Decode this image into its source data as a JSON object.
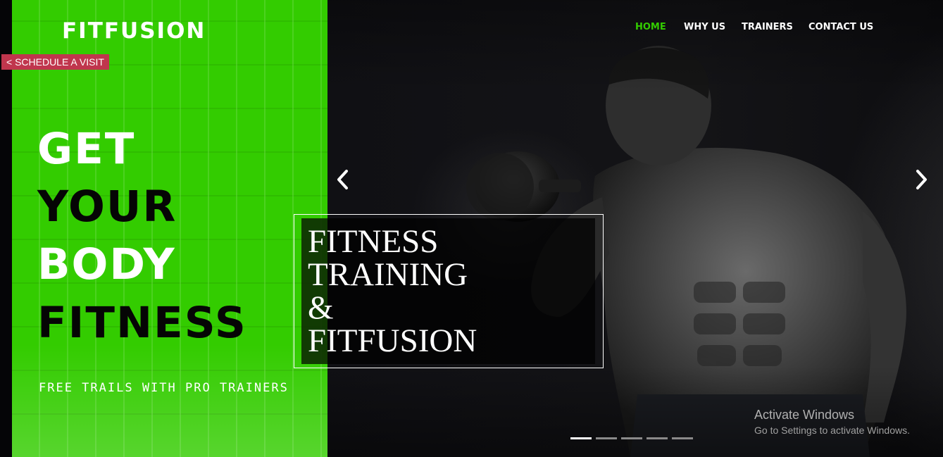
{
  "brand": {
    "name": "FITFUSION"
  },
  "schedule_button": {
    "label": "< SCHEDULE A VISIT"
  },
  "nav": {
    "items": [
      {
        "label": "HOME",
        "active": true
      },
      {
        "label": "WHY US",
        "active": false
      },
      {
        "label": "TRAINERS",
        "active": false
      },
      {
        "label": "CONTACT US",
        "active": false
      }
    ]
  },
  "hero": {
    "headline": [
      "GET",
      "YOUR",
      "BODY",
      "FITNESS"
    ],
    "tagline": "FREE TRAILS WITH PRO TRAINERS",
    "feature_lines": [
      "FITNESS",
      "TRAINING",
      "&",
      "FITFUSION"
    ]
  },
  "carousel": {
    "prev_icon": "chevron-left-icon",
    "next_icon": "chevron-right-icon",
    "slide_count": 5,
    "active_index": 0
  },
  "watermark": {
    "title": "Activate Windows",
    "subtitle": "Go to Settings to activate Windows."
  },
  "colors": {
    "accent_green": "#33cc00",
    "schedule_red": "#c0364d",
    "dark_bg": "#0b0b0f",
    "text_white": "#ffffff"
  }
}
